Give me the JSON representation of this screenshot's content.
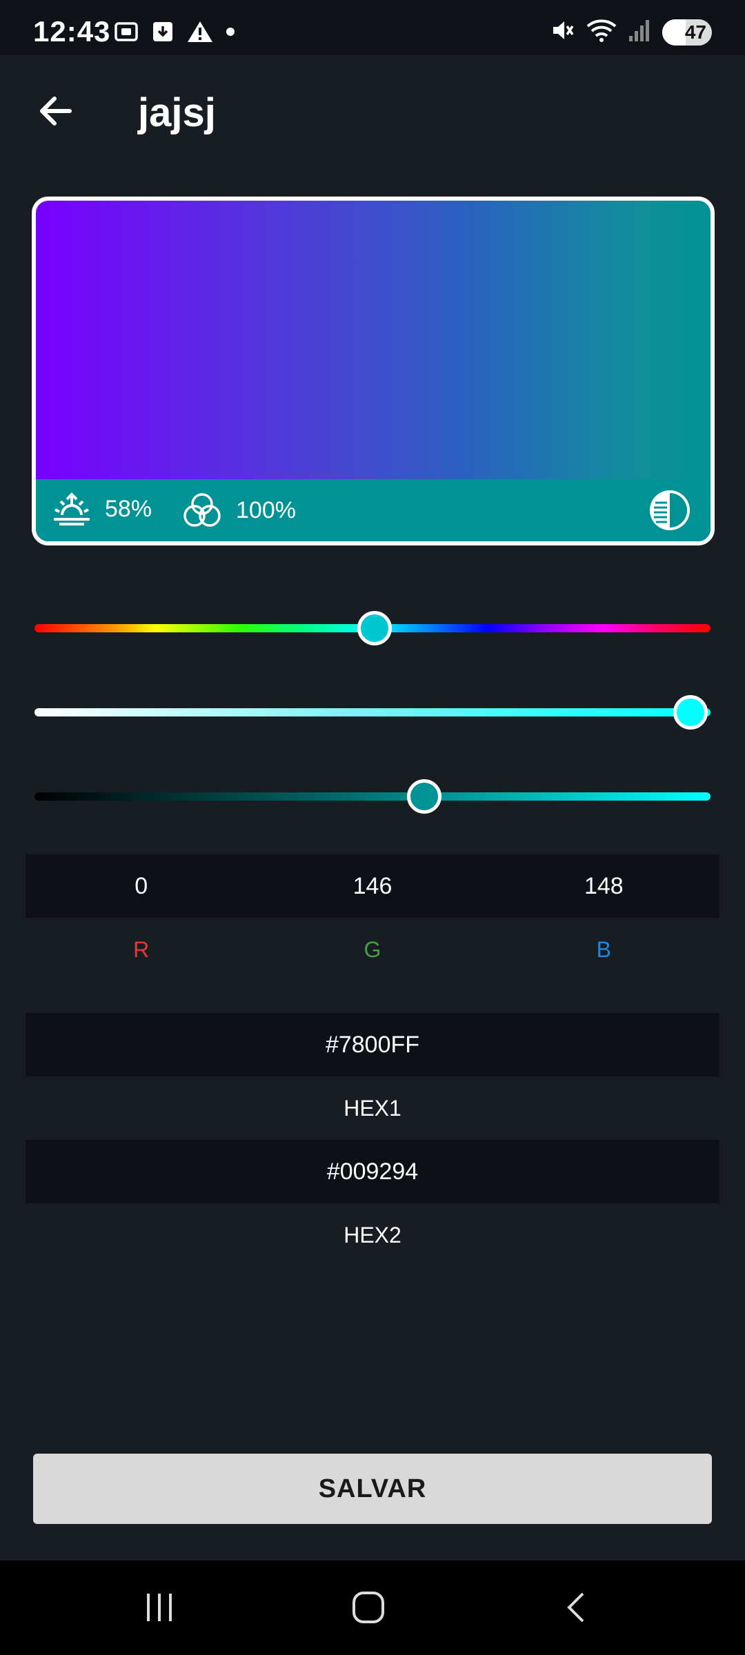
{
  "status_bar": {
    "time": "12:43",
    "battery_level": "47"
  },
  "header": {
    "title": "jajsj"
  },
  "preview": {
    "brightness_text": "58%",
    "saturation_text": "100%",
    "gradient_start": "#7800FF",
    "gradient_end": "#009294"
  },
  "sliders": {
    "hue_level": 0.503,
    "saturation_level": 0.97,
    "value_level": 0.577
  },
  "rgb": {
    "r_value": "0",
    "g_value": "146",
    "b_value": "148",
    "r_label": "R",
    "g_label": "G",
    "b_label": "B",
    "r_color": "#e53935",
    "g_color": "#43a047",
    "b_color": "#1e88e5"
  },
  "hex": {
    "hex1_value": "#7800FF",
    "hex1_label": "HEX1",
    "hex2_value": "#009294",
    "hex2_label": "HEX2"
  },
  "actions": {
    "save_label": "SALVAR"
  },
  "icons": [
    "camera-frame-icon",
    "download-box-icon",
    "warning-icon",
    "dot-icon",
    "mute-icon",
    "wifi-icon",
    "signal-icon",
    "battery-icon",
    "back-arrow-icon",
    "sunrise-icon",
    "color-circles-icon",
    "contrast-icon",
    "recents-icon",
    "home-icon",
    "nav-back-icon"
  ]
}
